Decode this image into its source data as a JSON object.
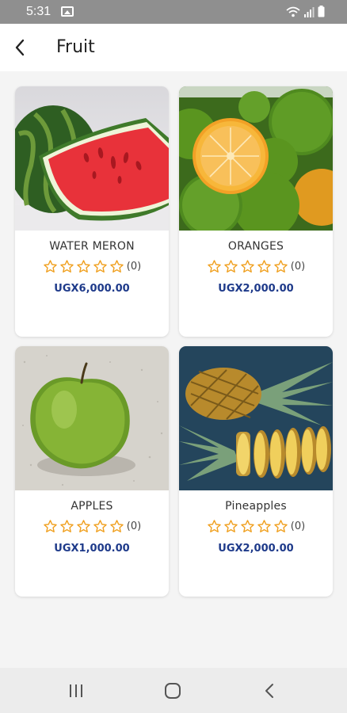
{
  "status_bar": {
    "time": "5:31"
  },
  "header": {
    "title": "Fruit"
  },
  "products": [
    {
      "name": "WATER MERON",
      "rating_count": "(0)",
      "price": "UGX6,000.00",
      "image": "watermelon-slice"
    },
    {
      "name": "ORANGES",
      "rating_count": "(0)",
      "price": "UGX2,000.00",
      "image": "oranges"
    },
    {
      "name": "APPLES",
      "rating_count": "(0)",
      "price": "UGX1,000.00",
      "image": "green-apple"
    },
    {
      "name": "Pineapples",
      "rating_count": "(0)",
      "price": "UGX2,000.00",
      "image": "pineapples"
    }
  ],
  "rating": {
    "max_stars": 5,
    "filled_stars": 0,
    "star_color": "#f0a020"
  },
  "colors": {
    "price": "#1e3a8a",
    "status_bar": "#8f8f8f",
    "background": "#f4f4f4"
  },
  "nav_bar": {
    "icons": [
      "recents-icon",
      "home-icon",
      "back-icon"
    ]
  }
}
